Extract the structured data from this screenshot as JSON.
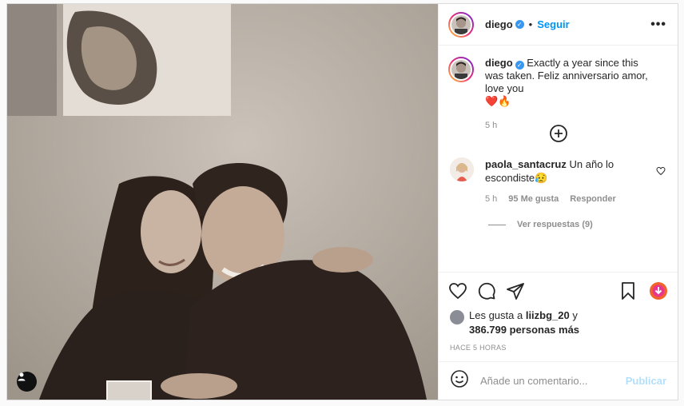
{
  "post": {
    "username": "diego",
    "follow_label": "Seguir",
    "dot": "•",
    "more": "•••"
  },
  "caption": {
    "username": "diego",
    "text": "Exactly a year since this was taken. Feliz anniversario amor, love you",
    "emojis": "❤️🔥",
    "time": "5 h"
  },
  "comment": {
    "username": "paola_santacruz",
    "text": "Un año lo escondiste😥",
    "time": "5 h",
    "likes": "95 Me gusta",
    "reply_label": "Responder",
    "view_replies": "Ver respuestas (9)"
  },
  "likes": {
    "prefix": "Les gusta a ",
    "user": "liizbg_20",
    "mid": " y",
    "count": "386.799 personas más"
  },
  "posted_ago": "HACE 5 HORAS",
  "comment_input": {
    "placeholder": "Añade un comentario...",
    "publish_label": "Publicar"
  },
  "icons": {
    "tag": "user-tag-icon",
    "like": "heart-icon",
    "comment": "comment-icon",
    "share": "paper-plane-icon",
    "save": "bookmark-icon",
    "emoji": "emoji-icon",
    "load_more": "plus-circle-icon"
  },
  "colors": {
    "accent": "#0095f6",
    "verified": "#3897f0",
    "publish_disabled": "#b2dffc"
  }
}
